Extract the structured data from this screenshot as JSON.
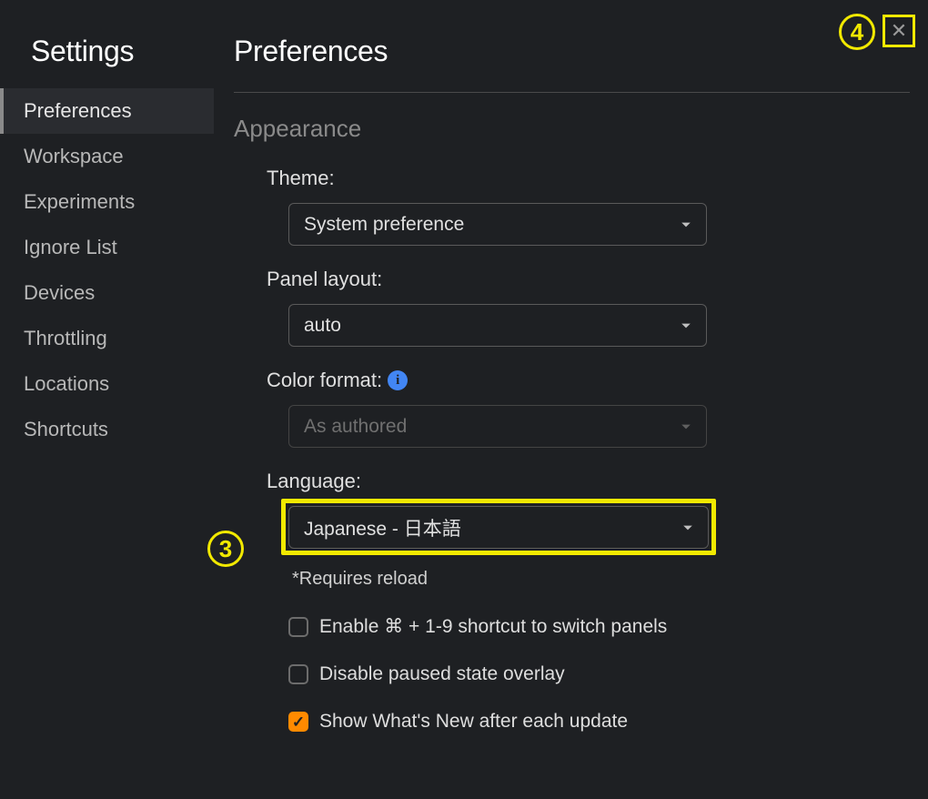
{
  "sidebar": {
    "title": "Settings",
    "items": [
      {
        "label": "Preferences",
        "active": true
      },
      {
        "label": "Workspace"
      },
      {
        "label": "Experiments"
      },
      {
        "label": "Ignore List"
      },
      {
        "label": "Devices"
      },
      {
        "label": "Throttling"
      },
      {
        "label": "Locations"
      },
      {
        "label": "Shortcuts"
      }
    ]
  },
  "main": {
    "title": "Preferences",
    "section": "Appearance",
    "fields": {
      "theme": {
        "label": "Theme:",
        "value": "System preference"
      },
      "panel_layout": {
        "label": "Panel layout:",
        "value": "auto"
      },
      "color_format": {
        "label": "Color format:",
        "value": "As authored",
        "disabled": true
      },
      "language": {
        "label": "Language:",
        "value": "Japanese - 日本語",
        "note": "*Requires reload"
      }
    },
    "checkboxes": {
      "shortcut": {
        "label": "Enable ⌘ + 1-9 shortcut to switch panels",
        "checked": false
      },
      "overlay": {
        "label": "Disable paused state overlay",
        "checked": false
      },
      "whatsnew": {
        "label": "Show What's New after each update",
        "checked": true
      }
    }
  },
  "annotations": {
    "marker3": "3",
    "marker4": "4"
  },
  "icons": {
    "info": "i",
    "close": "✕",
    "check": "✓"
  }
}
